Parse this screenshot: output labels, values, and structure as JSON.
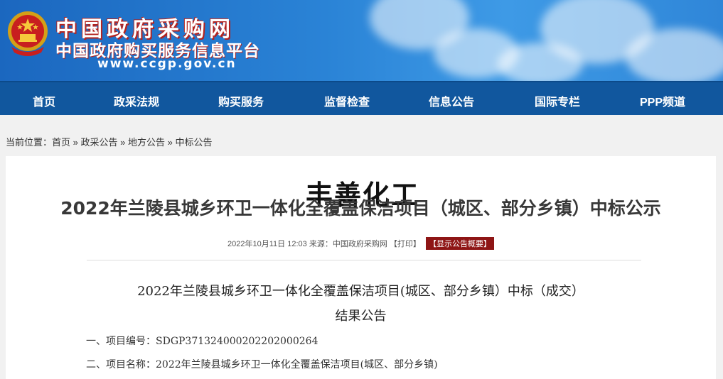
{
  "header": {
    "site_title": "中国政府采购网",
    "site_subtitle": "中国政府购买服务信息平台",
    "site_url": "www.ccgp.gov.cn"
  },
  "nav": {
    "items": [
      {
        "label": "首页"
      },
      {
        "label": "政采法规"
      },
      {
        "label": "购买服务"
      },
      {
        "label": "监督检查"
      },
      {
        "label": "信息公告"
      },
      {
        "label": "国际专栏"
      },
      {
        "label": "PPP频道"
      }
    ]
  },
  "breadcrumb": {
    "prefix": "当前位置：",
    "items": [
      "首页",
      "政采公告",
      "地方公告",
      "中标公告"
    ],
    "separator": "»"
  },
  "article": {
    "watermark": "丰善化工",
    "title": "2022年兰陵县城乡环卫一体化全覆盖保洁项目（城区、部分乡镇）中标公示",
    "meta": {
      "date": "2022年10月11日 12:03",
      "source_label": "来源：",
      "source": "中国政府采购网",
      "print_label": "【打印】",
      "summary_label": "【显示公告概要】"
    },
    "notice_title_line1": "2022年兰陵县城乡环卫一体化全覆盖保洁项目(城区、部分乡镇）中标（成交）",
    "notice_title_line2": "结果公告",
    "fields": [
      {
        "label": "一、项目编号：",
        "value": "SDGP371324000202202000264"
      },
      {
        "label": "二、项目名称：",
        "value": "2022年兰陵县城乡环卫一体化全覆盖保洁项目(城区、部分乡镇)"
      }
    ]
  },
  "colors": {
    "banner_blue": "#2a83d6",
    "nav_blue": "#11579e",
    "accent_red": "#8e1515"
  }
}
